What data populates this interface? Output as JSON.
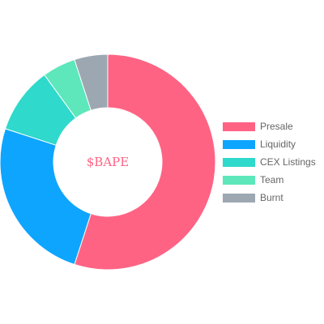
{
  "chart_data": {
    "type": "pie",
    "variant": "doughnut",
    "center_text": "$BAPE",
    "legend_position": "right",
    "categories": [
      "Presale",
      "Liquidity",
      "CEX Listings",
      "Team",
      "Burnt"
    ],
    "values": [
      55,
      25,
      10,
      5,
      5
    ],
    "colors": [
      "#ff6384",
      "#0ea5ff",
      "#2fd9cb",
      "#5de7ba",
      "#9ca7b2"
    ]
  }
}
